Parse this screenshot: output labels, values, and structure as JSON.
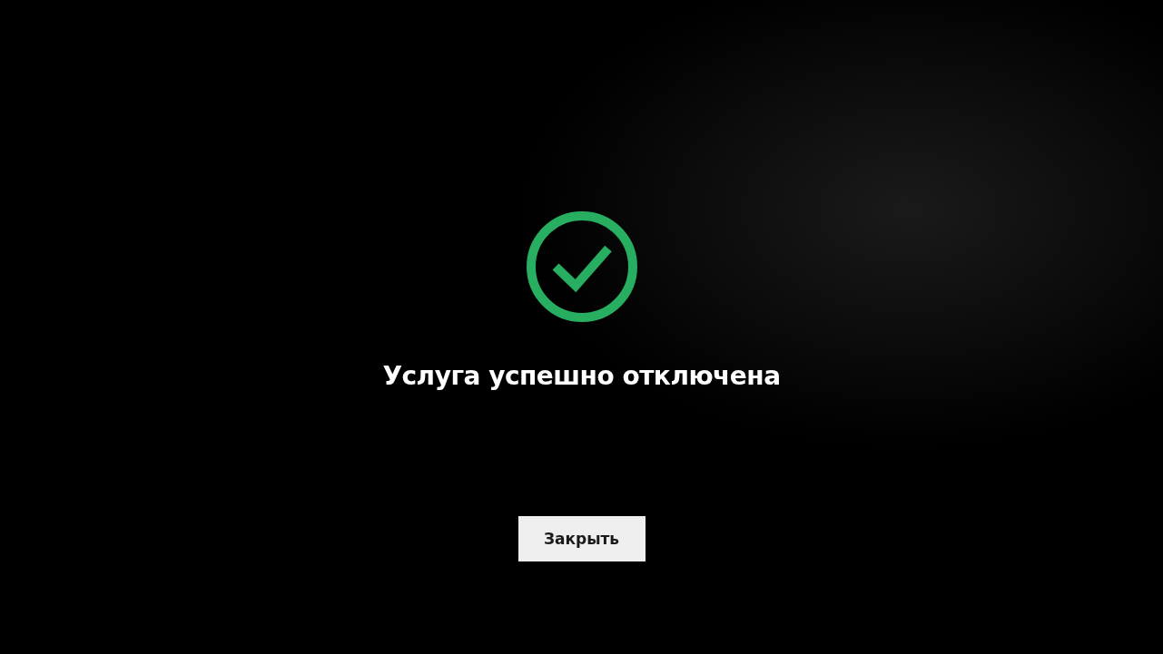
{
  "status": {
    "kind": "success",
    "message": "Услуга успешно отключена"
  },
  "buttons": [
    {
      "label": "Закрыть"
    }
  ]
}
